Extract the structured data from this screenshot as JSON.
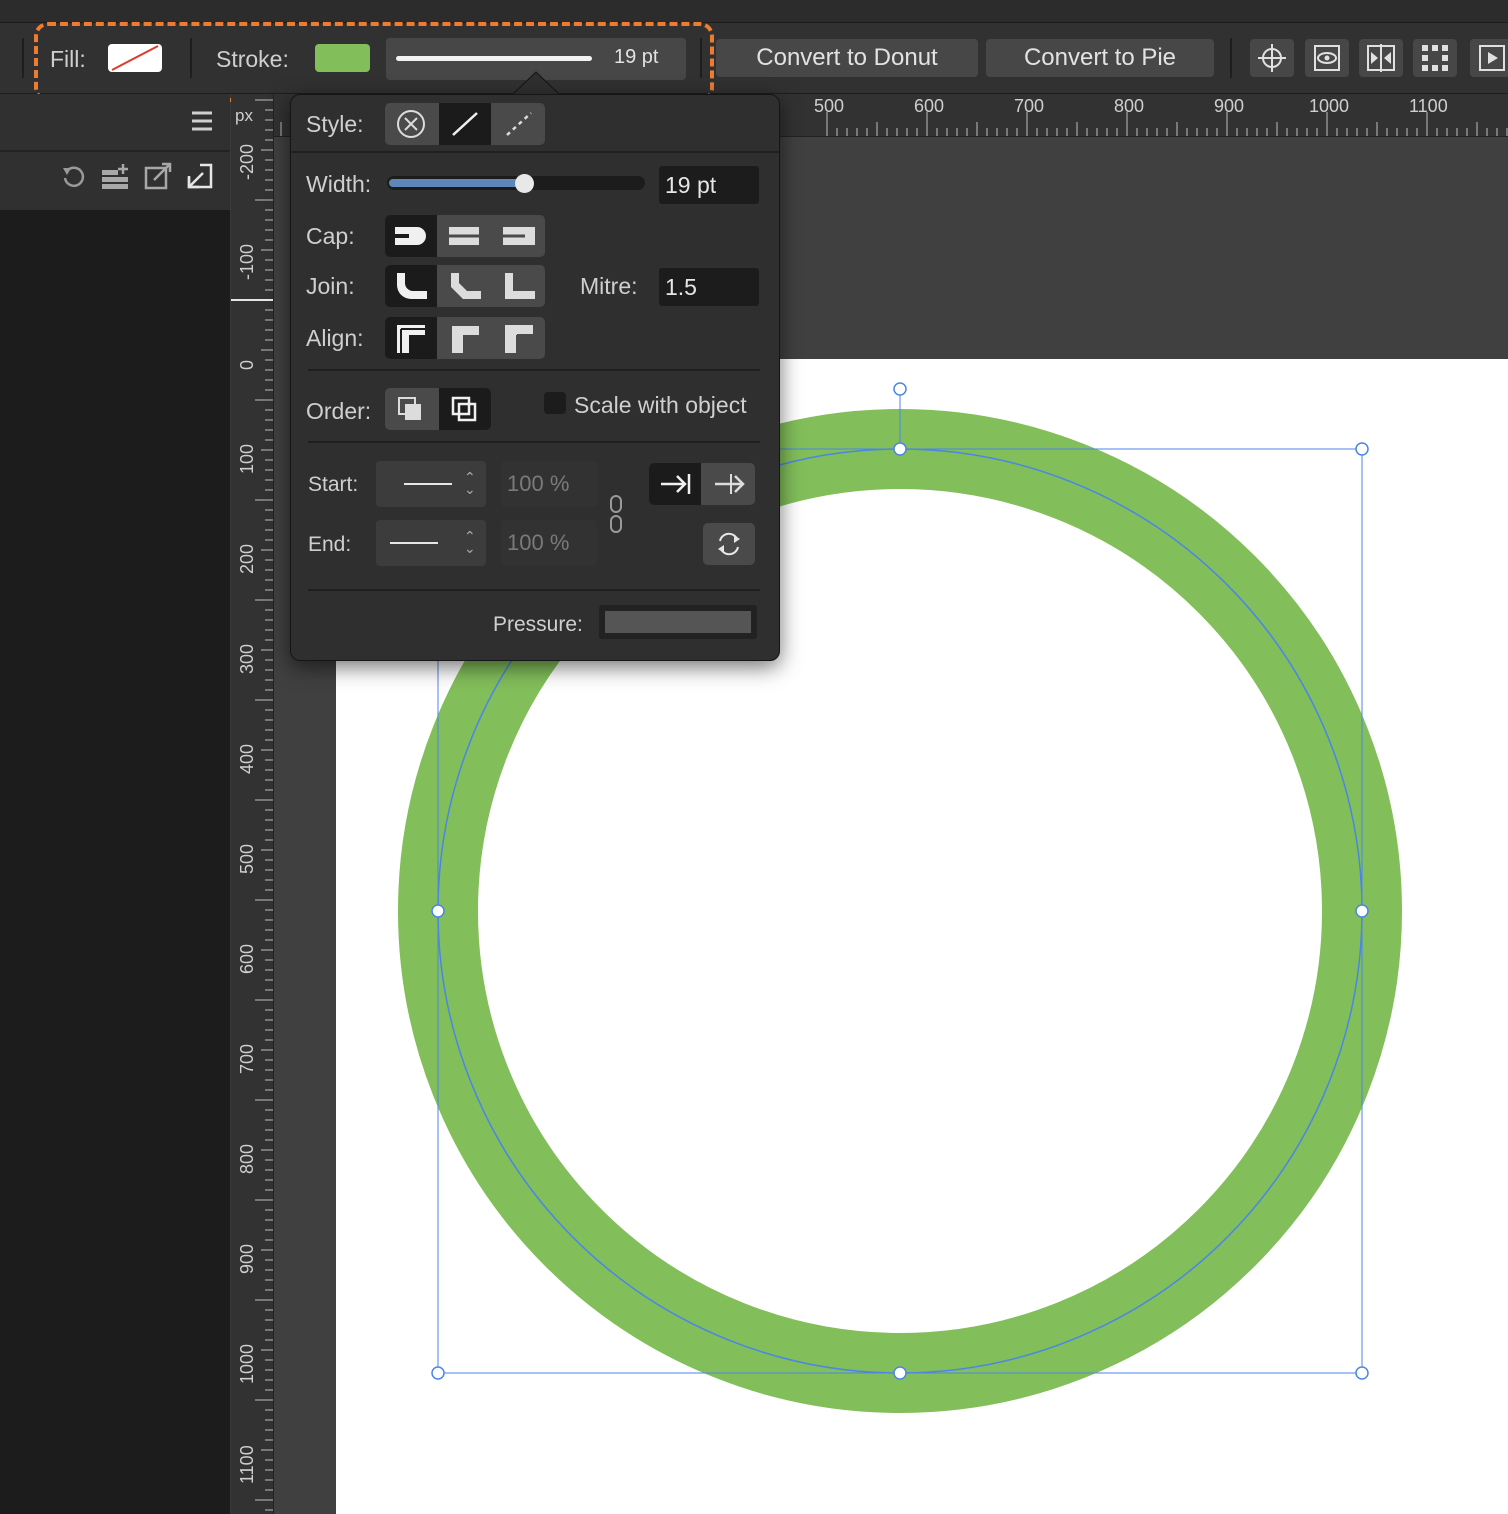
{
  "toolbar": {
    "fill_label": "Fill:",
    "stroke_label": "Stroke:",
    "stroke_width_value": "19 pt",
    "convert_to_donut": "Convert to Donut",
    "convert_to_pie": "Convert to Pie",
    "stroke_color": "#82be5a",
    "fill_swatch": "none (white with red slash)"
  },
  "rulers": {
    "unit": "px",
    "horizontal": [
      "500",
      "600",
      "700",
      "800",
      "900",
      "1000",
      "1100"
    ],
    "vertical": [
      "-200",
      "-100",
      "0",
      "100",
      "200",
      "300",
      "400",
      "500",
      "600",
      "700",
      "800",
      "900",
      "1000",
      "1100"
    ]
  },
  "stroke_panel": {
    "style_label": "Style:",
    "width_label": "Width:",
    "width_value": "19 pt",
    "width_slider_fraction": 0.53,
    "cap_label": "Cap:",
    "join_label": "Join:",
    "mitre_label": "Mitre:",
    "mitre_value": "1.5",
    "align_label": "Align:",
    "order_label": "Order:",
    "scale_with_object": "Scale with object",
    "start_label": "Start:",
    "end_label": "End:",
    "start_scale": "100 %",
    "end_scale": "100 %",
    "pressure_label": "Pressure:"
  },
  "canvas": {
    "shape": "ellipse",
    "stroke_color": "#82be5a",
    "selection_color": "#4a86e8"
  }
}
